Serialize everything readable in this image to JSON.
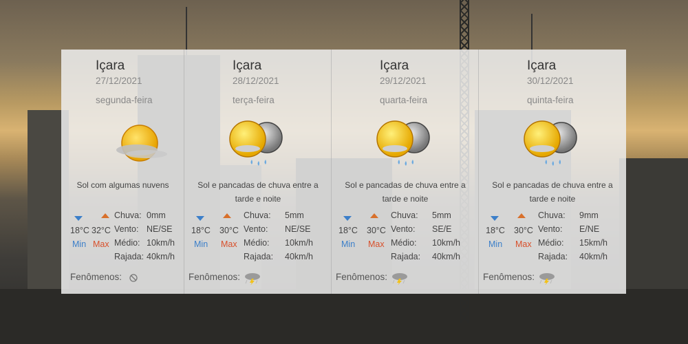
{
  "min_label": "Min",
  "max_label": "Max",
  "labels": {
    "chuva": "Chuva:",
    "vento": "Vento:",
    "medio": "Médio:",
    "rajada": "Rajada:",
    "fenomenos": "Fenômenos:"
  },
  "colors": {
    "min": "#3c7fc9",
    "max": "#d8502b",
    "panel": "#eeeeee"
  },
  "days": [
    {
      "city": "Içara",
      "date": "27/12/2021",
      "weekday": "segunda-feira",
      "icon": "sun-cloud-icon",
      "desc1": "Sol com algumas nuvens",
      "desc2": "",
      "min": "18°C",
      "max": "32°C",
      "chuva": "0mm",
      "vento": "NE/SE",
      "medio": "10km/h",
      "rajada": "40km/h",
      "fenomenos_icon": "none-icon"
    },
    {
      "city": "Içara",
      "date": "28/12/2021",
      "weekday": "terça-feira",
      "icon": "sun-moon-rain-icon",
      "desc1": "Sol e pancadas de chuva entre a",
      "desc2": "tarde e noite",
      "min": "18°C",
      "max": "30°C",
      "chuva": "5mm",
      "vento": "NE/SE",
      "medio": "10km/h",
      "rajada": "40km/h",
      "fenomenos_icon": "storm-icon"
    },
    {
      "city": "Içara",
      "date": "29/12/2021",
      "weekday": "quarta-feira",
      "icon": "sun-moon-rain-icon",
      "desc1": "Sol e pancadas de chuva entre a",
      "desc2": "tarde e noite",
      "min": "18°C",
      "max": "30°C",
      "chuva": "5mm",
      "vento": "SE/E",
      "medio": "10km/h",
      "rajada": "40km/h",
      "fenomenos_icon": "storm-icon"
    },
    {
      "city": "Içara",
      "date": "30/12/2021",
      "weekday": "quinta-feira",
      "icon": "sun-moon-rain-icon",
      "desc1": "Sol e pancadas de chuva entre a",
      "desc2": "tarde e noite",
      "min": "18°C",
      "max": "30°C",
      "chuva": "9mm",
      "vento": "E/NE",
      "medio": "15km/h",
      "rajada": "40km/h",
      "fenomenos_icon": "storm-icon"
    }
  ]
}
